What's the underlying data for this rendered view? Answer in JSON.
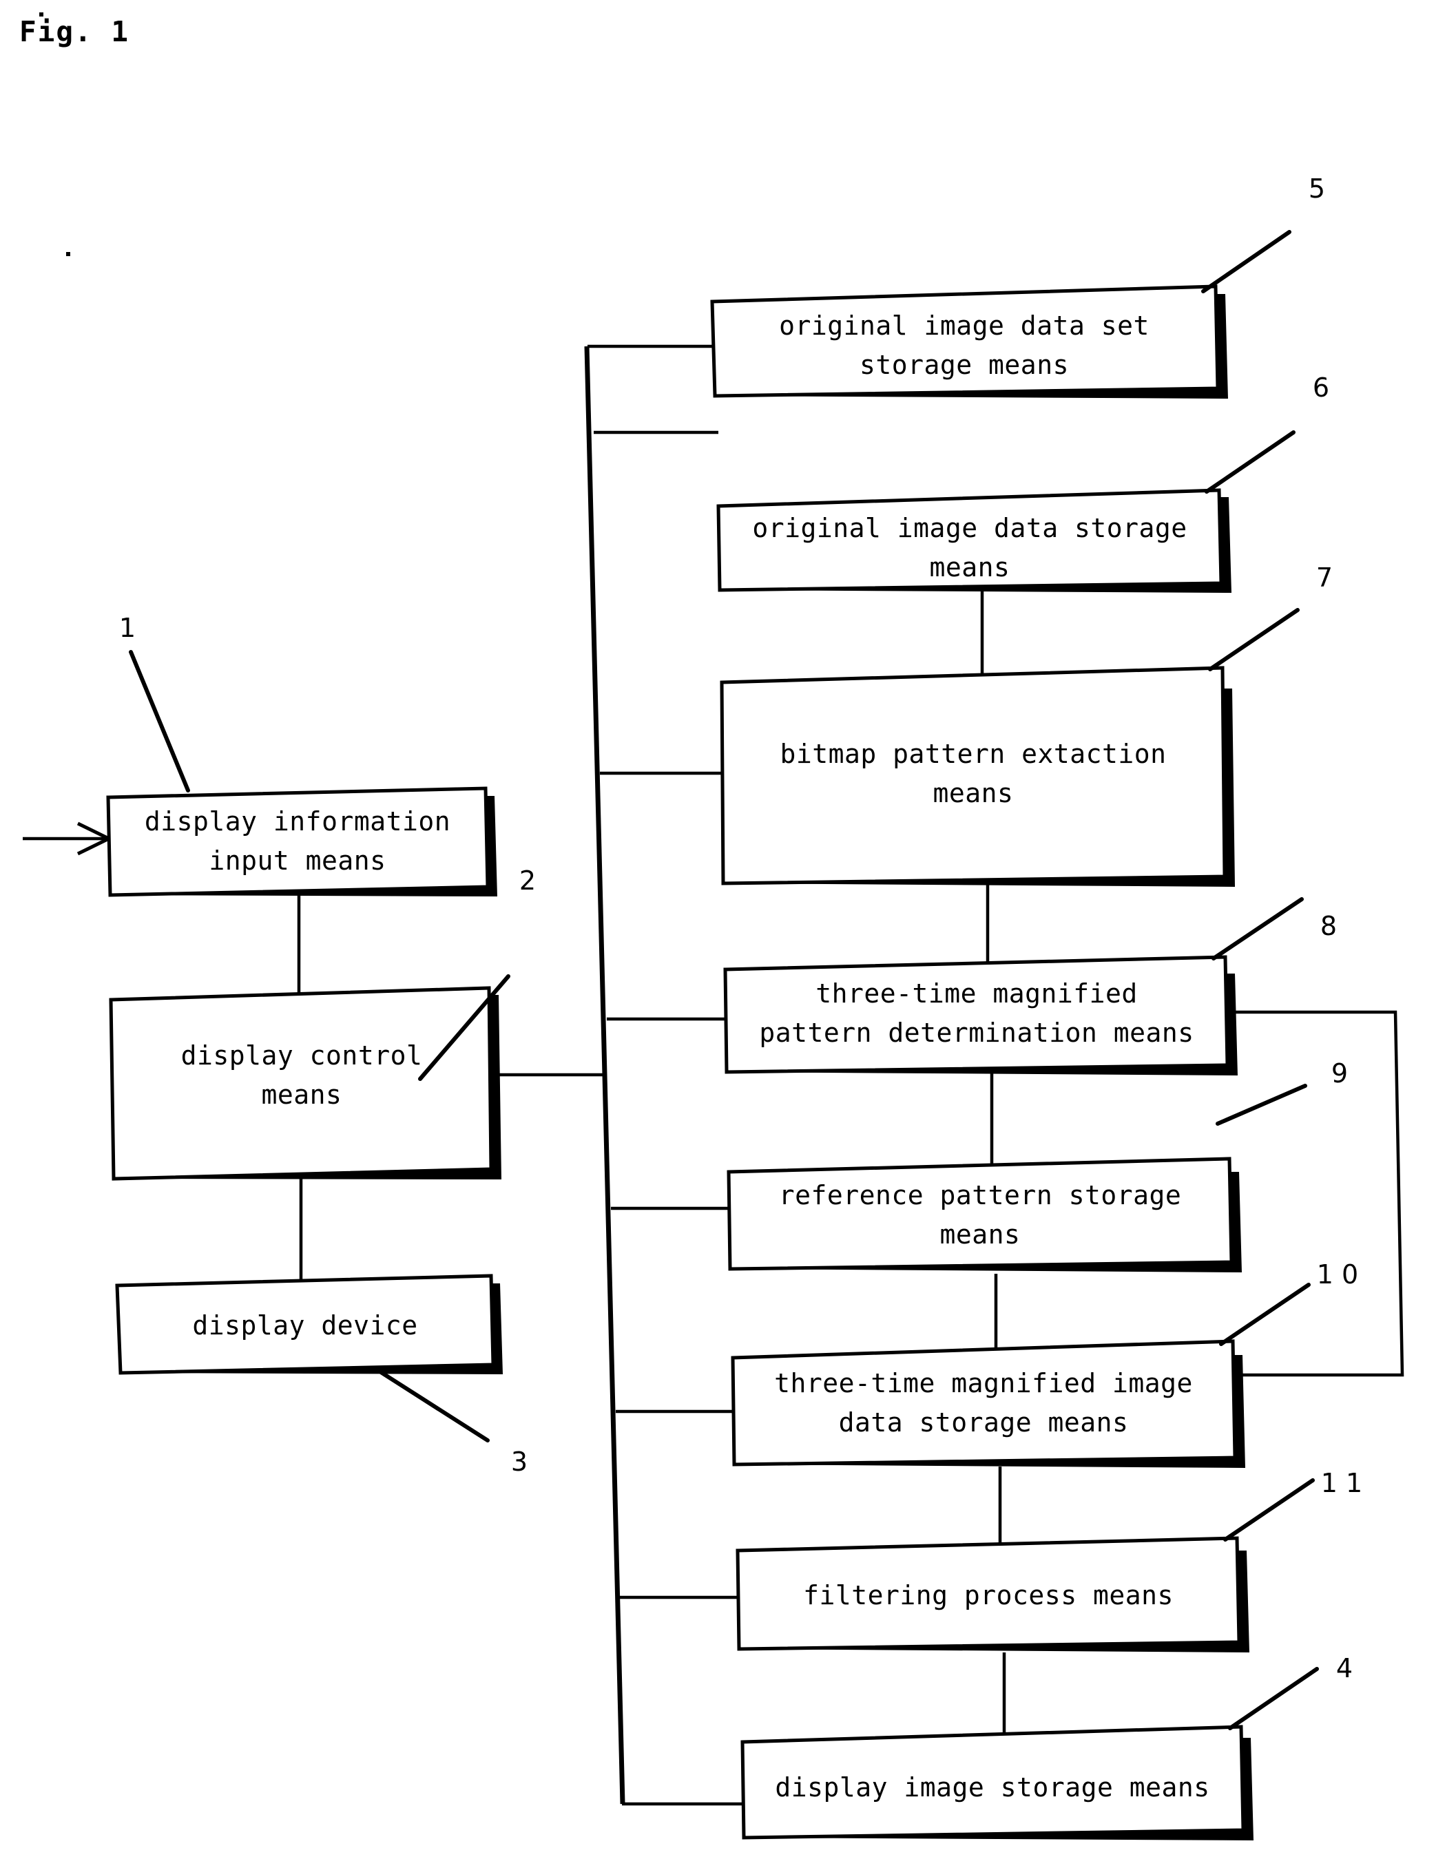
{
  "figure": {
    "label": "Fig. 1",
    "type": "patent-block-diagram"
  },
  "blocks": [
    {
      "id": "display-information-input-means",
      "ref": "1",
      "lines": [
        "display information",
        "input means"
      ]
    },
    {
      "id": "display-control-means",
      "ref": "2",
      "lines": [
        "display control",
        "means"
      ]
    },
    {
      "id": "display-device",
      "ref": "3",
      "lines": [
        "display device"
      ]
    },
    {
      "id": "original-image-data-set-storage-means",
      "ref": "5",
      "lines": [
        "original image data set",
        "storage means"
      ]
    },
    {
      "id": "original-image-data-storage-means",
      "ref": "6",
      "lines": [
        "original image data storage",
        "means"
      ]
    },
    {
      "id": "bitmap-pattern-extaction-means",
      "ref": "7",
      "lines": [
        "bitmap pattern extaction",
        "means"
      ]
    },
    {
      "id": "three-time-magnified-pattern-determination-means",
      "ref": "8",
      "lines": [
        "three-time magnified",
        "pattern determination means"
      ]
    },
    {
      "id": "reference-pattern-storage-means",
      "ref": "9",
      "lines": [
        "reference pattern storage",
        "means"
      ]
    },
    {
      "id": "three-time-magnified-image-data-storage-means",
      "ref": "1 0",
      "lines": [
        "three-time magnified image",
        "data storage means"
      ]
    },
    {
      "id": "filtering-process-means",
      "ref": "1 1",
      "lines": [
        "filtering process means"
      ]
    },
    {
      "id": "display-image-storage-means",
      "ref": "4",
      "lines": [
        "display image storage means"
      ]
    }
  ],
  "reference_numerals": [
    "1",
    "2",
    "3",
    "4",
    "5",
    "6",
    "7",
    "8",
    "9",
    "1 0",
    "1 1"
  ],
  "colors": {
    "ink": "#000000",
    "paper": "#ffffff"
  }
}
